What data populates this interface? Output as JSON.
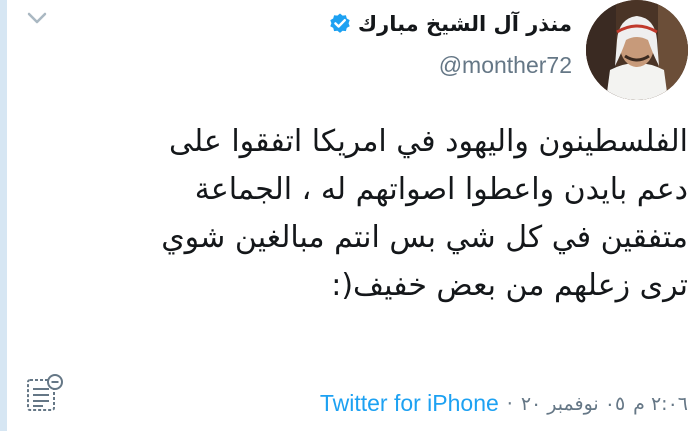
{
  "tweet": {
    "author_name": "منذر آل الشيخ مبارك",
    "handle": "@monther72",
    "lines": [
      "الفلسطينون واليهود في امريكا اتفقوا على",
      "دعم بايدن واعطوا اصواتهم له ، الجماعة",
      "متفقين في كل شي بس انتم مبالغين شوي",
      "ترى زعلهم من بعض خفيف(:"
    ],
    "time": "٢:٠٦ م",
    "date": "٠٥ نوفمبر ٢٠",
    "separator": "·",
    "source": "Twitter for iPhone"
  },
  "icons": {
    "verified": "verified-badge-icon",
    "menu": "chevron-down-icon",
    "analytics": "tweet-analytics-icon",
    "accent": "#1da1f2"
  }
}
